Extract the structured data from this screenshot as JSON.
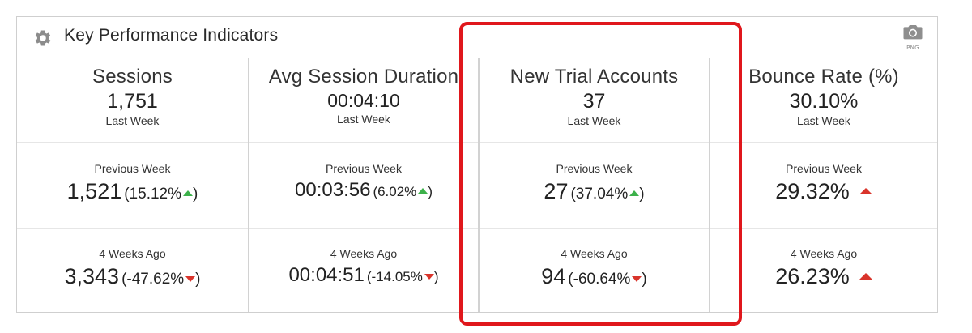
{
  "widget": {
    "title": "Key Performance Indicators",
    "export_label": "PNG",
    "icons": {
      "settings": "gear-icon",
      "export": "camera-icon"
    },
    "colors": {
      "up": "#3cb14a",
      "down": "#d9342b",
      "highlight": "#e0171c"
    }
  },
  "kpis": [
    {
      "name": "Sessions",
      "value": "1,751",
      "period": "Last Week",
      "prev_label": "Previous Week",
      "prev_value": "1,521",
      "prev_change": "(15.12%",
      "prev_close": ")",
      "prev_trend": "up",
      "ago_label": "4 Weeks Ago",
      "ago_value": "3,343",
      "ago_change": "(-47.62%",
      "ago_close": ")",
      "ago_trend": "down"
    },
    {
      "name": "Avg Session Duration",
      "value": "00:04:10",
      "period": "Last Week",
      "prev_label": "Previous Week",
      "prev_value": "00:03:56",
      "prev_change": "(6.02%",
      "prev_close": ")",
      "prev_trend": "up",
      "ago_label": "4 Weeks Ago",
      "ago_value": "00:04:51",
      "ago_change": "(-14.05%",
      "ago_close": ")",
      "ago_trend": "down"
    },
    {
      "name": "New Trial Accounts",
      "value": "37",
      "period": "Last Week",
      "prev_label": "Previous Week",
      "prev_value": "27",
      "prev_change": "(37.04%",
      "prev_close": ")",
      "prev_trend": "up",
      "ago_label": "4 Weeks Ago",
      "ago_value": "94",
      "ago_change": "(-60.64%",
      "ago_close": ")",
      "ago_trend": "down"
    },
    {
      "name": "Bounce Rate (%)",
      "value": "30.10%",
      "period": "Last Week",
      "prev_label": "Previous Week",
      "prev_value": "29.32%",
      "prev_trend": "up-bad",
      "ago_label": "4 Weeks Ago",
      "ago_value": "26.23%",
      "ago_trend": "up-bad"
    }
  ],
  "annotation": {
    "highlighted_kpi": "New Trial Accounts"
  }
}
